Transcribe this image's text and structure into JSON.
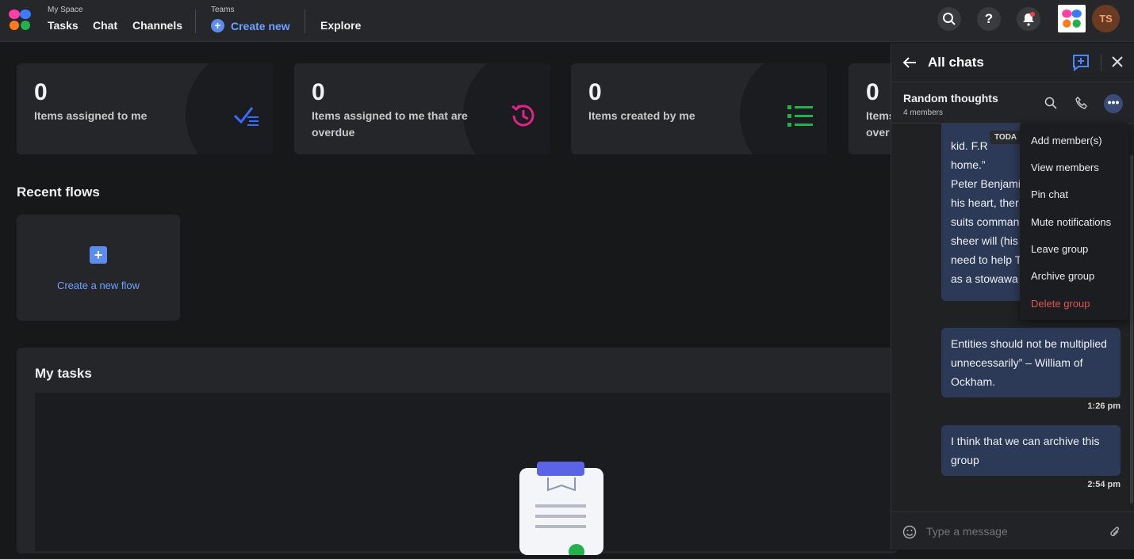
{
  "topnav": {
    "myspace_label": "My Space",
    "tasks": "Tasks",
    "chat": "Chat",
    "channels": "Channels",
    "teams_label": "Teams",
    "create_new": "Create new",
    "explore": "Explore",
    "avatar_initials": "TS"
  },
  "cards": [
    {
      "count": "0",
      "label": "Items assigned to me",
      "icon": "checklist-icon"
    },
    {
      "count": "0",
      "label": "Items assigned to me that are overdue",
      "icon": "history-clock-icon"
    },
    {
      "count": "0",
      "label": "Items created by me",
      "icon": "list-icon"
    },
    {
      "count": "0",
      "label": "Items assigned to me that are overdue",
      "icon": "list-icon"
    }
  ],
  "card4_visible": {
    "line1": "Items",
    "line2": "over"
  },
  "recent_flows": {
    "title": "Recent flows",
    "create_label": "Create a new flow"
  },
  "my_tasks": {
    "title": "My tasks"
  },
  "chat": {
    "header_title": "All chats",
    "group_name": "Random thoughts",
    "group_members": "4 members",
    "today_tag": "TODA",
    "messages": [
      {
        "lines": [
          "kid. F.R",
          "home.”",
          "Peter Benjami",
          "his heart, ther",
          "suits comman",
          "sheer will (his",
          "need to help T",
          "as a stowawa"
        ]
      },
      {
        "text": "Entities should not be multiplied unnecessarily” – William of Ockham.",
        "time": "1:26 pm"
      },
      {
        "text": "I think that we can archive this group",
        "time": "2:54 pm"
      }
    ],
    "input_placeholder": "Type a message",
    "menu": [
      "Add member(s)",
      "View members",
      "Pin chat",
      "Mute notifications",
      "Leave group",
      "Archive group",
      "Delete group"
    ],
    "colors": {
      "accent": "#5b8def",
      "bubble": "#2d3a57",
      "danger": "#e05555"
    }
  }
}
